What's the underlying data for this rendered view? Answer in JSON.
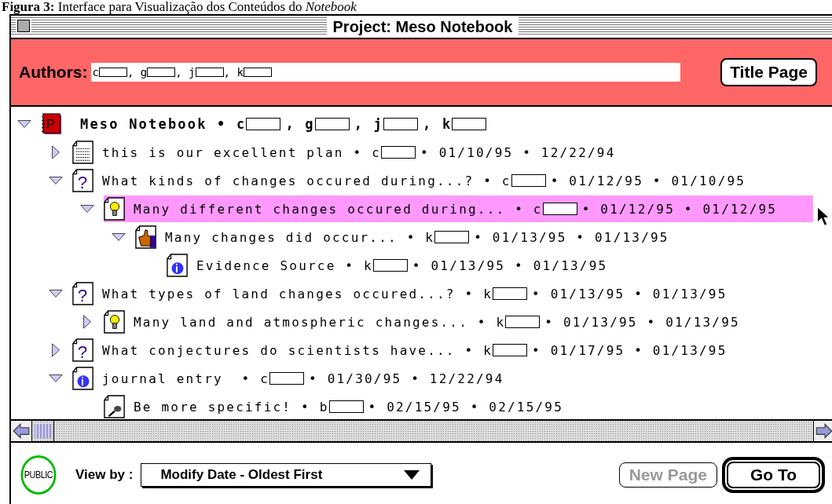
{
  "caption": "**Figura 3:** Interface para Visualização dos Conteúdos do *Notebook*",
  "window": {
    "title": "Project: Meso Notebook"
  },
  "authors_bar": {
    "label": "Authors:",
    "authors": [
      {
        "text": "c"
      },
      {
        "text": ", g"
      },
      {
        "text": ", j"
      },
      {
        "text": ", k"
      }
    ],
    "button": "Title Page"
  },
  "tree": [
    {
      "kind": "notebook",
      "glyph": "P",
      "expanded": true,
      "selected": false,
      "parts": [
        {
          "text": "Meso Notebook • c",
          "redacted_after": true
        },
        {
          "text": ", g",
          "redacted_after": true
        },
        {
          "text": ", j",
          "redacted_after": true
        },
        {
          "text": ", k",
          "redacted_after": true
        }
      ],
      "children": [
        {
          "kind": "text",
          "expanded": false,
          "selected": false,
          "parts": [
            {
              "text": "this is our excellent plan • c",
              "redacted_after": true
            },
            {
              "text": "• 01/10/95 • 12/22/94",
              "redacted_after": false
            }
          ]
        },
        {
          "kind": "question",
          "glyph": "?",
          "expanded": true,
          "selected": false,
          "parts": [
            {
              "text": "What kinds of changes occured during...? • c",
              "redacted_after": true
            },
            {
              "text": "• 01/12/95 • 01/10/95",
              "redacted_after": false
            }
          ],
          "children": [
            {
              "kind": "idea",
              "expanded": true,
              "selected": true,
              "parts": [
                {
                  "text": "Many different changes occured during... • c",
                  "redacted_after": true
                },
                {
                  "text": "• 01/12/95 • 01/12/95",
                  "redacted_after": false
                }
              ],
              "children": [
                {
                  "kind": "evidence",
                  "expanded": true,
                  "selected": false,
                  "parts": [
                    {
                      "text": "Many changes did occur... • k",
                      "redacted_after": true
                    },
                    {
                      "text": "• 01/13/95 • 01/13/95",
                      "redacted_after": false
                    }
                  ],
                  "children": [
                    {
                      "kind": "info",
                      "glyph": "i",
                      "selected": false,
                      "parts": [
                        {
                          "text": "Evidence Source • k",
                          "redacted_after": true
                        },
                        {
                          "text": "• 01/13/95 • 01/13/95",
                          "redacted_after": false
                        }
                      ]
                    }
                  ]
                }
              ]
            }
          ]
        },
        {
          "kind": "question",
          "glyph": "?",
          "expanded": true,
          "selected": false,
          "parts": [
            {
              "text": "What types of land changes occured...? • k",
              "redacted_after": true
            },
            {
              "text": "• 01/13/95 • 01/13/95",
              "redacted_after": false
            }
          ],
          "children": [
            {
              "kind": "idea",
              "expanded": false,
              "selected": false,
              "parts": [
                {
                  "text": "Many land and atmospheric changes... • k",
                  "redacted_after": true
                },
                {
                  "text": "• 01/13/95 • 01/13/95",
                  "redacted_after": false
                }
              ]
            }
          ]
        },
        {
          "kind": "question",
          "glyph": "?",
          "expanded": false,
          "selected": false,
          "parts": [
            {
              "text": "What conjectures do scientists have... • k",
              "redacted_after": true
            },
            {
              "text": "• 01/17/95 • 01/13/95",
              "redacted_after": false
            }
          ]
        },
        {
          "kind": "info",
          "glyph": "i",
          "expanded": true,
          "selected": false,
          "parts": [
            {
              "text": "journal entry  • c",
              "redacted_after": true
            },
            {
              "text": "• 01/30/95 • 12/22/94",
              "redacted_after": false
            }
          ],
          "children": [
            {
              "kind": "note",
              "selected": false,
              "parts": [
                {
                  "text": "Be more specific! • b",
                  "redacted_after": true
                },
                {
                  "text": "• 02/15/95 • 02/15/95",
                  "redacted_after": false
                }
              ]
            }
          ]
        }
      ]
    }
  ],
  "footer": {
    "badge": "PUBLIC",
    "view_by_label": "View by :",
    "view_by_value": "Modify Date - Oldest First",
    "buttons": [
      {
        "label": "New Page",
        "disabled": true,
        "default": false
      },
      {
        "label": "Go To",
        "disabled": false,
        "default": true
      }
    ]
  }
}
